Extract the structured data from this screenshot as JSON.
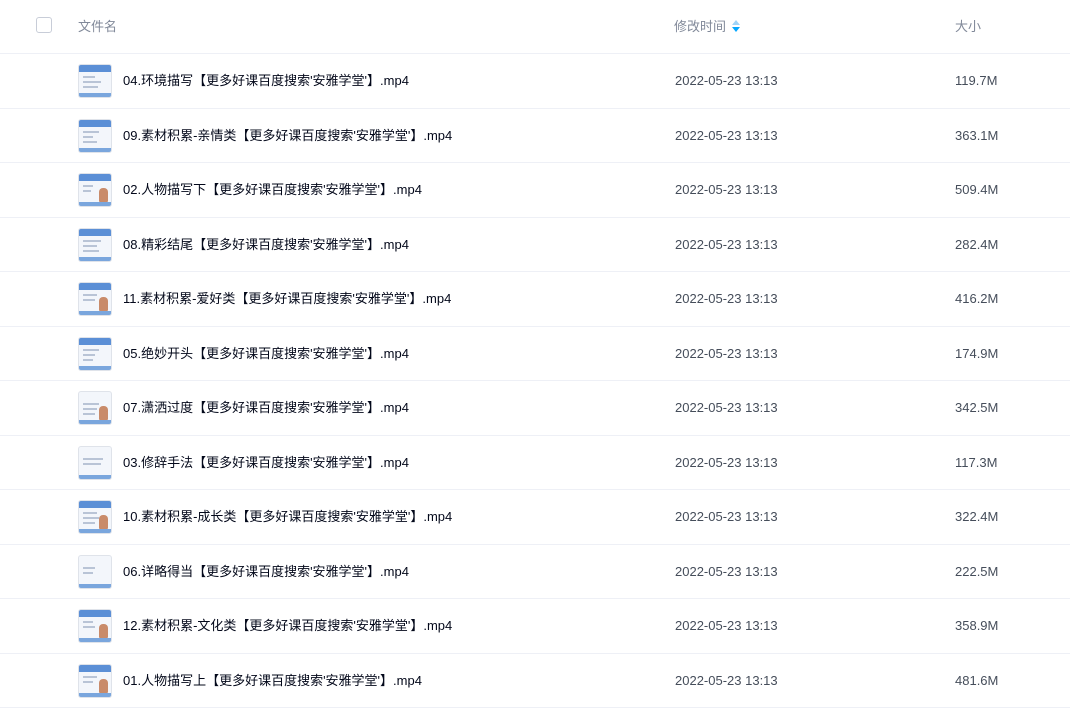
{
  "header": {
    "name_label": "文件名",
    "time_label": "修改时间",
    "size_label": "大小"
  },
  "colors": {
    "sort_accent": "#06a7ff",
    "text": "#03081a",
    "muted": "#818999"
  },
  "files": [
    {
      "name": "04.环境描写【更多好课百度搜索'安雅学堂'】.mp4",
      "time": "2022-05-23 13:13",
      "size": "119.7M"
    },
    {
      "name": "09.素材积累-亲情类【更多好课百度搜索'安雅学堂'】.mp4",
      "time": "2022-05-23 13:13",
      "size": "363.1M"
    },
    {
      "name": "02.人物描写下【更多好课百度搜索'安雅学堂'】.mp4",
      "time": "2022-05-23 13:13",
      "size": "509.4M"
    },
    {
      "name": "08.精彩结尾【更多好课百度搜索'安雅学堂'】.mp4",
      "time": "2022-05-23 13:13",
      "size": "282.4M"
    },
    {
      "name": "11.素材积累-爱好类【更多好课百度搜索'安雅学堂'】.mp4",
      "time": "2022-05-23 13:13",
      "size": "416.2M"
    },
    {
      "name": "05.绝妙开头【更多好课百度搜索'安雅学堂'】.mp4",
      "time": "2022-05-23 13:13",
      "size": "174.9M"
    },
    {
      "name": "07.潇洒过度【更多好课百度搜索'安雅学堂'】.mp4",
      "time": "2022-05-23 13:13",
      "size": "342.5M"
    },
    {
      "name": "03.修辞手法【更多好课百度搜索'安雅学堂'】.mp4",
      "time": "2022-05-23 13:13",
      "size": "117.3M"
    },
    {
      "name": "10.素材积累-成长类【更多好课百度搜索'安雅学堂'】.mp4",
      "time": "2022-05-23 13:13",
      "size": "322.4M"
    },
    {
      "name": "06.详略得当【更多好课百度搜索'安雅学堂'】.mp4",
      "time": "2022-05-23 13:13",
      "size": "222.5M"
    },
    {
      "name": "12.素材积累-文化类【更多好课百度搜索'安雅学堂'】.mp4",
      "time": "2022-05-23 13:13",
      "size": "358.9M"
    },
    {
      "name": "01.人物描写上【更多好课百度搜索'安雅学堂'】.mp4",
      "time": "2022-05-23 13:13",
      "size": "481.6M"
    }
  ]
}
